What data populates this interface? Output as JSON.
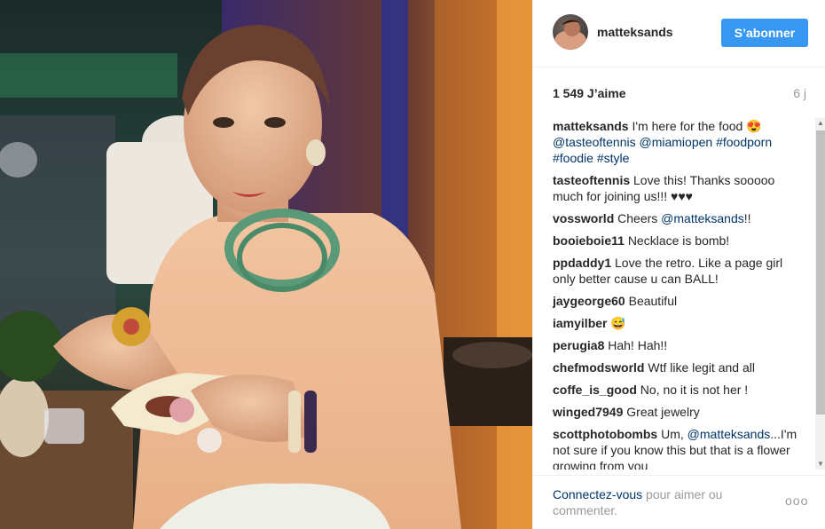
{
  "post": {
    "username": "matteksands",
    "follow_label": "S’abonner",
    "likes": "1 549 J’aime",
    "age": "6 j"
  },
  "comments": [
    {
      "user": "matteksands",
      "text": "I'm here for the food 😍 ",
      "links": "@tasteoftennis @miamiopen #foodporn #foodie #style"
    },
    {
      "user": "tasteoftennis",
      "text": "Love this! Thanks sooooo much for joining us!!! ♥♥♥"
    },
    {
      "user": "vossworld",
      "text": "Cheers ",
      "link": "@matteksands",
      "after": "!!"
    },
    {
      "user": "booieboie11",
      "text": "Necklace is bomb!"
    },
    {
      "user": "ppdaddy1",
      "text": "Love the retro. Like a page girl only better cause u can BALL!"
    },
    {
      "user": "jaygeorge60",
      "text": "Beautiful"
    },
    {
      "user": "iamyilber",
      "text": "😅"
    },
    {
      "user": "perugia8",
      "text": "Hah! Hah!!"
    },
    {
      "user": "chefmodsworld",
      "text": "Wtf like legit and all"
    },
    {
      "user": "coffe_is_good",
      "text": "No, no it is not her !"
    },
    {
      "user": "winged7949",
      "text": "Great jewelry"
    },
    {
      "user": "scottphotobombs",
      "text": "Um, ",
      "link": "@matteksands",
      "after": "...I'm not sure if you know this but that is a flower growing from you"
    }
  ],
  "footer": {
    "login_link": "Connectez-vous",
    "login_text": " pour aimer ou commenter.",
    "more": "ooo"
  },
  "colors": {
    "follow_bg": "#3897f0",
    "link": "#003569",
    "muted": "#999999"
  }
}
